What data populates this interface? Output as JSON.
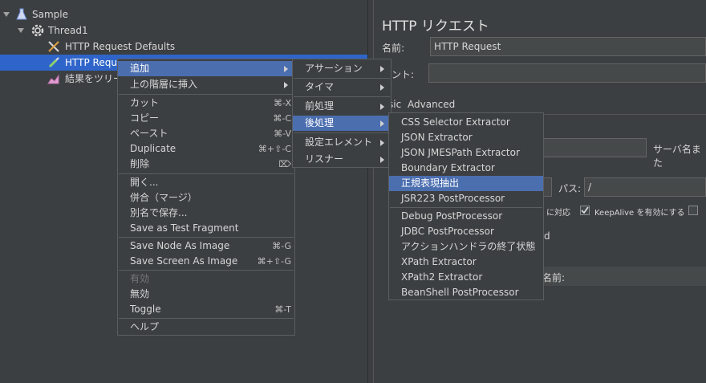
{
  "tree": {
    "nodes": [
      {
        "label": "Sample"
      },
      {
        "label": "Thread1"
      },
      {
        "label": "HTTP Request Defaults"
      },
      {
        "label": "HTTP Reque"
      },
      {
        "label": "結果をツリー"
      }
    ]
  },
  "right_panel": {
    "title": "HTTP リクエスト",
    "name_label": "名前:",
    "name_value": "HTTP Request",
    "comment_label": "メント:",
    "tabs": [
      "sic",
      "Advanced"
    ],
    "server_label": "サーバ名また",
    "path_label": "パス:",
    "path_value": "/",
    "encoding_partial": "に対応",
    "keepalive_label": "KeepAlive を有効にする",
    "partial_d": "d",
    "name_col_label": "名前:"
  },
  "context_menu": {
    "items": [
      {
        "label": "追加",
        "shortcut": "",
        "submenu": true
      },
      {
        "label": "上の階層に挿入",
        "shortcut": "",
        "submenu": true
      },
      {
        "label": "カット",
        "shortcut": "⌘-X"
      },
      {
        "label": "コピー",
        "shortcut": "⌘-C"
      },
      {
        "label": "ペースト",
        "shortcut": "⌘-V"
      },
      {
        "label": "Duplicate",
        "shortcut": "⌘+⇧-C"
      },
      {
        "label": "削除",
        "shortcut": "⌦"
      },
      {
        "label": "開く...",
        "shortcut": ""
      },
      {
        "label": "併合（マージ）",
        "shortcut": ""
      },
      {
        "label": "別名で保存...",
        "shortcut": ""
      },
      {
        "label": "Save as Test Fragment",
        "shortcut": ""
      },
      {
        "label": "Save Node As Image",
        "shortcut": "⌘-G"
      },
      {
        "label": "Save Screen As Image",
        "shortcut": "⌘+⇧-G"
      },
      {
        "label": "有効",
        "shortcut": ""
      },
      {
        "label": "無効",
        "shortcut": ""
      },
      {
        "label": "Toggle",
        "shortcut": "⌘-T"
      },
      {
        "label": "ヘルプ",
        "shortcut": ""
      }
    ]
  },
  "add_submenu": {
    "items": [
      {
        "label": "アサーション"
      },
      {
        "label": "タイマ"
      },
      {
        "label": "前処理"
      },
      {
        "label": "後処理"
      },
      {
        "label": "設定エレメント"
      },
      {
        "label": "リスナー"
      }
    ]
  },
  "postprocessor_submenu": {
    "items": [
      {
        "label": "CSS Selector Extractor"
      },
      {
        "label": "JSON Extractor"
      },
      {
        "label": "JSON JMESPath Extractor"
      },
      {
        "label": "Boundary Extractor"
      },
      {
        "label": "正規表現抽出"
      },
      {
        "label": "JSR223 PostProcessor"
      },
      {
        "label": "Debug PostProcessor"
      },
      {
        "label": "JDBC PostProcessor"
      },
      {
        "label": "アクションハンドラの終了状態"
      },
      {
        "label": "XPath Extractor"
      },
      {
        "label": "XPath2 Extractor"
      },
      {
        "label": "BeanShell PostProcessor"
      }
    ]
  },
  "colors": {
    "background": "#3c3f41",
    "selection": "#2f65ca",
    "menu_highlight": "#4b6eaf"
  }
}
